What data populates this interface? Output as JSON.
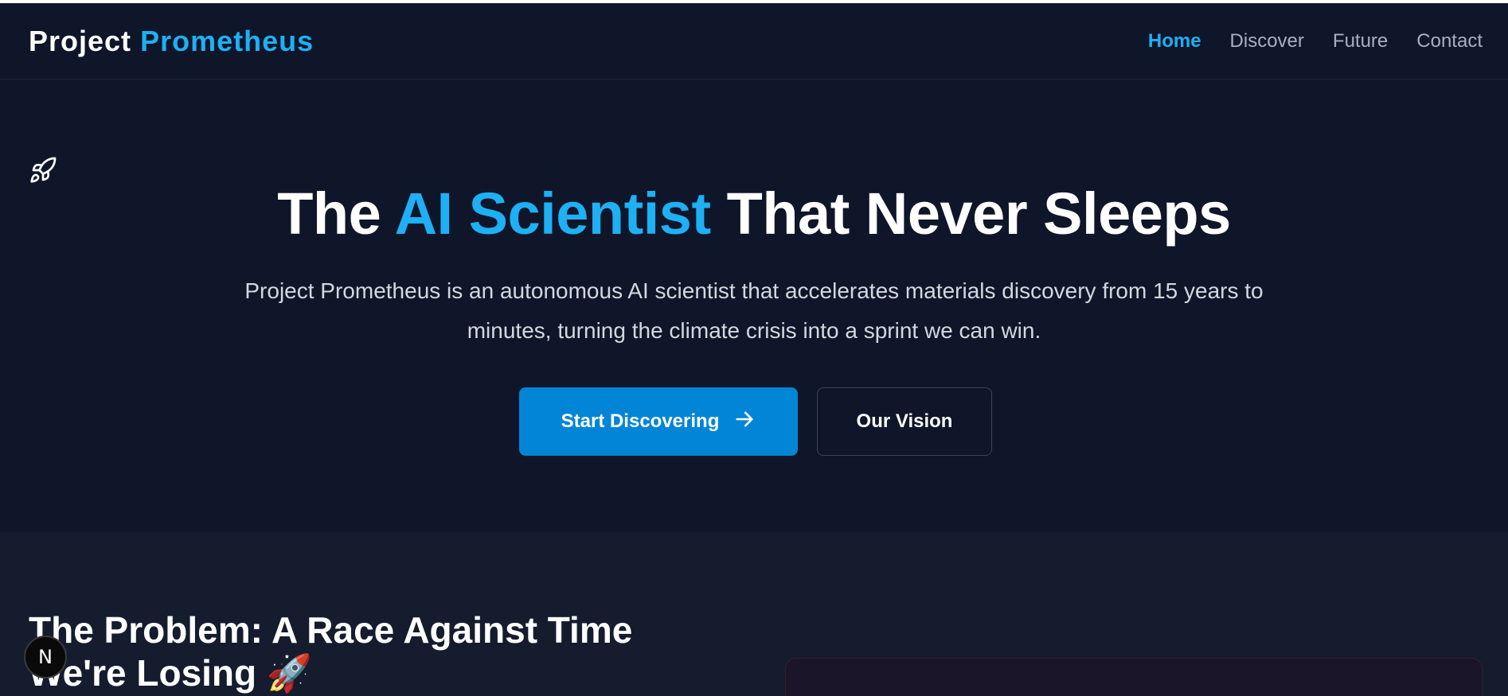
{
  "navbar": {
    "brand_primary": "Project",
    "brand_accent": "Prometheus",
    "links": [
      {
        "label": "Home",
        "active": true
      },
      {
        "label": "Discover",
        "active": false
      },
      {
        "label": "Future",
        "active": false
      },
      {
        "label": "Contact",
        "active": false
      }
    ]
  },
  "hero": {
    "icon": "rocket-icon",
    "title_before": "The",
    "title_accent": "AI Scientist",
    "title_after": "That Never Sleeps",
    "subtitle": "Project Prometheus is an autonomous AI scientist that accelerates materials discovery from 15 years to minutes, turning the climate crisis into a sprint we can win.",
    "primary_button": "Start Discovering",
    "secondary_button": "Our Vision"
  },
  "problem": {
    "title": "The Problem: A Race Against Time We're Losing 🚀"
  },
  "dev_badge": {
    "letter": "N"
  },
  "colors": {
    "background": "#0f1629",
    "section_background": "#141c2e",
    "accent": "#1eb0f4",
    "primary_button": "#0285d6",
    "nav_inactive": "#a7b0bf"
  }
}
